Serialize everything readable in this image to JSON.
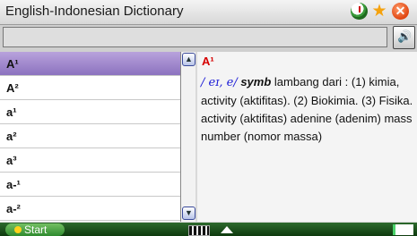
{
  "window": {
    "title": "English-Indonesian Dictionary",
    "close_glyph": "✕",
    "star_glyph": "★"
  },
  "search": {
    "value": "",
    "placeholder": ""
  },
  "speaker": {
    "glyph": "🔊"
  },
  "list": {
    "items": [
      "A¹",
      "A²",
      "a¹",
      "a²",
      "a³",
      "a-¹",
      "a-²"
    ]
  },
  "scroll": {
    "up": "▲",
    "down": "▼"
  },
  "entry": {
    "head": "A¹",
    "pron": "/ eɪ, e/",
    "pos": "symb",
    "line1": " lambang dari : (1) kimia, activity (aktifitas). (2) Biokimia. (3) Fisika.",
    "line2": "activity (aktifitas) adenine (adenim) mass number (nomor massa)"
  },
  "taskbar": {
    "start": "Start"
  },
  "colors": {
    "accent": "#8c72bf",
    "entry_red": "#d60000",
    "pron_blue": "#1a1ad6",
    "taskbar": "#0e3a0e"
  }
}
